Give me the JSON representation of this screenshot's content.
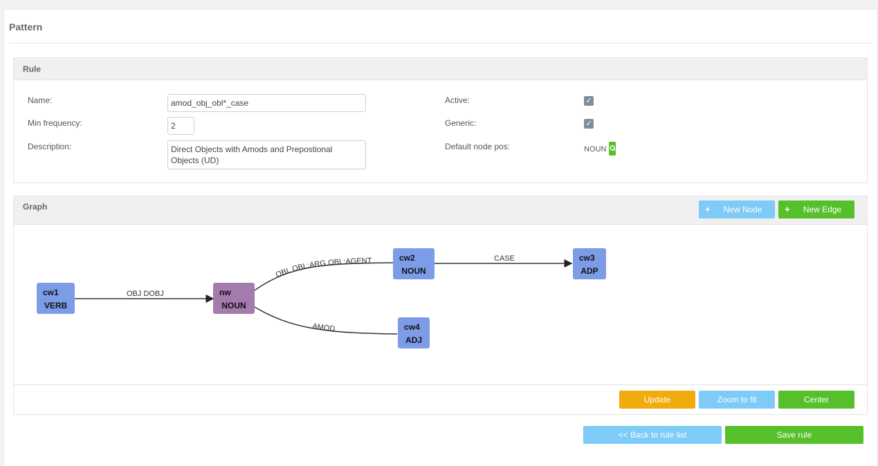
{
  "page": {
    "title": "Pattern"
  },
  "rule": {
    "heading": "Rule",
    "name_label": "Name:",
    "name_value": "amod_obj_obl*_case",
    "minfreq_label": "Min frequency:",
    "minfreq_value": "2",
    "description_label": "Description:",
    "description_value": "Direct Objects with Amods and Prepostional Objects (UD)",
    "active_label": "Active:",
    "active_checked": true,
    "generic_label": "Generic:",
    "generic_checked": true,
    "default_pos_label": "Default node pos:",
    "default_pos_value": "NOUN"
  },
  "graph": {
    "heading": "Graph",
    "new_node_label": "New Node",
    "new_edge_label": "New Edge",
    "nodes": [
      {
        "id": "cw1",
        "pos": "VERB",
        "color": "#7d9ce8"
      },
      {
        "id": "nw",
        "pos": "NOUN",
        "color": "#a37bac"
      },
      {
        "id": "cw2",
        "pos": "NOUN",
        "color": "#7d9ce8"
      },
      {
        "id": "cw3",
        "pos": "ADP",
        "color": "#7d9ce8"
      },
      {
        "id": "cw4",
        "pos": "ADJ",
        "color": "#7d9ce8"
      }
    ],
    "edges": [
      {
        "from": "cw1",
        "to": "nw",
        "label": "OBJ DOBJ"
      },
      {
        "from": "nw",
        "to": "cw2",
        "label": "OBL OBL:ARG OBL:AGENT"
      },
      {
        "from": "cw2",
        "to": "cw3",
        "label": "CASE"
      },
      {
        "from": "nw",
        "to": "cw4",
        "label": "AMOD"
      }
    ],
    "update_label": "Update",
    "zoom_label": "Zoom to fit",
    "center_label": "Center"
  },
  "footer": {
    "back_label": "<< Back to rule list",
    "save_label": "Save rule"
  },
  "colors": {
    "green": "#56c02b",
    "blue": "#7dcbf6",
    "orange": "#f0ab0d",
    "node_blue": "#7d9ce8",
    "node_purple": "#a37bac"
  }
}
